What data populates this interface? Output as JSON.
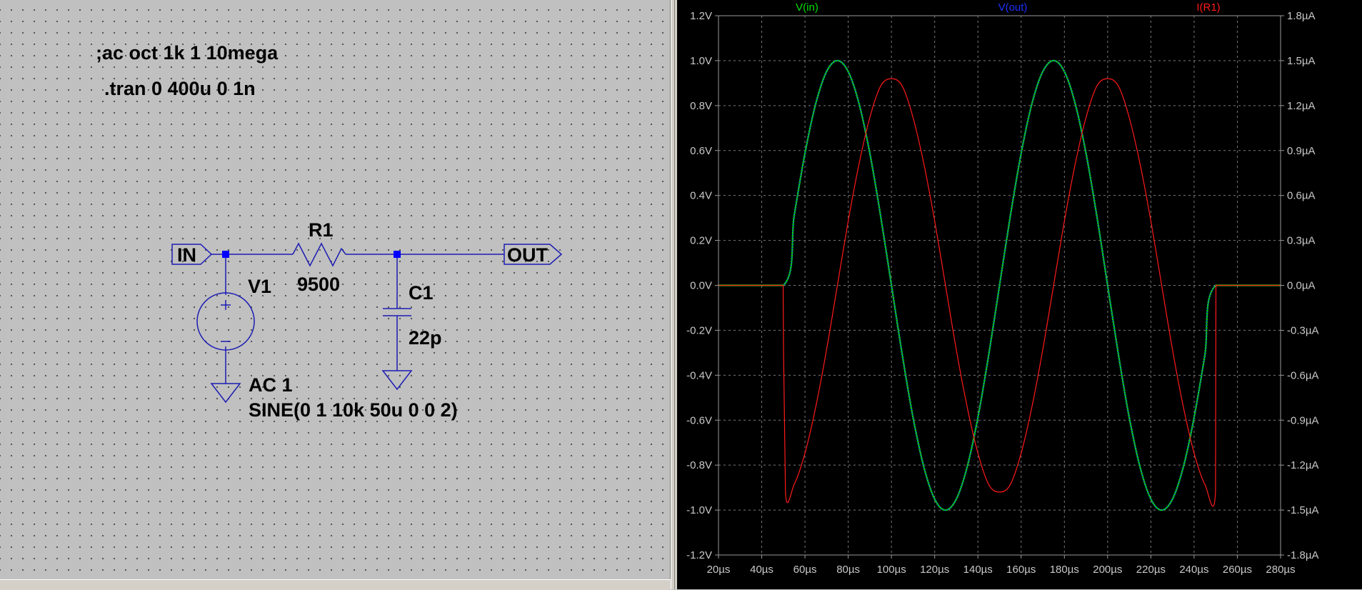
{
  "schematic": {
    "directives": [
      ";ac oct 1k 1 10mega",
      ".tran 0 400u 0 1n"
    ],
    "net_in": "IN",
    "net_out": "OUT",
    "resistor": {
      "name": "R1",
      "value": "9500"
    },
    "capacitor": {
      "name": "C1",
      "value": "22p"
    },
    "source": {
      "name": "V1",
      "ac": "AC 1",
      "tran": "SINE(0 1 10k 50u 0 0 2)"
    },
    "wire_color": "#1c1cb4",
    "node_color": "#0000ff"
  },
  "waveform": {
    "traces": [
      {
        "name": "V(in)",
        "color": "#00e000"
      },
      {
        "name": "V(out)",
        "color": "#2030ff"
      },
      {
        "name": "I(R1)",
        "color": "#ff1a1a"
      }
    ],
    "x_ticks": [
      "20µs",
      "40µs",
      "60µs",
      "80µs",
      "100µs",
      "120µs",
      "140µs",
      "160µs",
      "180µs",
      "200µs",
      "220µs",
      "240µs",
      "260µs",
      "280µs"
    ],
    "y_left_ticks": [
      "1.2V",
      "1.0V",
      "0.8V",
      "0.6V",
      "0.4V",
      "0.2V",
      "0.0V",
      "-0.2V",
      "-0.4V",
      "-0.6V",
      "-0.8V",
      "-1.0V",
      "-1.2V"
    ],
    "y_right_ticks": [
      "1.8µA",
      "1.5µA",
      "1.2µA",
      "0.9µA",
      "0.6µA",
      "0.3µA",
      "0.0µA",
      "-0.3µA",
      "-0.6µA",
      "-0.9µA",
      "-1.2µA",
      "-1.5µA",
      "-1.8µA"
    ]
  },
  "chart_data": {
    "type": "line",
    "x_unit": "µs",
    "xlim": [
      20,
      280
    ],
    "ylim_left": [
      -1.2,
      1.2
    ],
    "ylim_right": [
      -1.8,
      1.8
    ],
    "y_left_unit": "V",
    "y_right_unit": "µA",
    "grid": true,
    "series": [
      {
        "name": "V(in)",
        "axis": "left",
        "color": "#00e000",
        "x": [
          20,
          50,
          55,
          60,
          65,
          70,
          75,
          80,
          85,
          90,
          95,
          100,
          105,
          110,
          115,
          120,
          125,
          130,
          135,
          140,
          145,
          150,
          155,
          160,
          165,
          170,
          175,
          180,
          185,
          190,
          195,
          200,
          205,
          210,
          215,
          220,
          225,
          230,
          235,
          240,
          245,
          250,
          280
        ],
        "y": [
          0,
          0,
          0.309,
          0.588,
          0.809,
          0.951,
          1.0,
          0.951,
          0.809,
          0.588,
          0.309,
          0,
          -0.309,
          -0.588,
          -0.809,
          -0.951,
          -1.0,
          -0.951,
          -0.809,
          -0.588,
          -0.309,
          0,
          0.309,
          0.588,
          0.809,
          0.951,
          1.0,
          0.951,
          0.809,
          0.588,
          0.309,
          0,
          -0.309,
          -0.588,
          -0.809,
          -0.951,
          -1.0,
          -0.951,
          -0.809,
          -0.588,
          -0.309,
          0,
          0
        ]
      },
      {
        "name": "V(out)",
        "axis": "left",
        "color": "#2030ff",
        "x": [
          20,
          50,
          55,
          60,
          65,
          70,
          75,
          80,
          85,
          90,
          95,
          100,
          105,
          110,
          115,
          120,
          125,
          130,
          135,
          140,
          145,
          150,
          155,
          160,
          165,
          170,
          175,
          180,
          185,
          190,
          195,
          200,
          205,
          210,
          215,
          220,
          225,
          230,
          235,
          240,
          245,
          250,
          280
        ],
        "y": [
          0,
          0,
          0.309,
          0.588,
          0.809,
          0.951,
          1.0,
          0.951,
          0.809,
          0.588,
          0.309,
          0,
          -0.309,
          -0.588,
          -0.809,
          -0.951,
          -1.0,
          -0.951,
          -0.809,
          -0.588,
          -0.309,
          0,
          0.309,
          0.588,
          0.809,
          0.951,
          1.0,
          0.951,
          0.809,
          0.588,
          0.309,
          0,
          -0.309,
          -0.588,
          -0.809,
          -0.951,
          -1.0,
          -0.951,
          -0.809,
          -0.588,
          -0.309,
          0,
          0
        ]
      },
      {
        "name": "I(R1)",
        "axis": "right",
        "color": "#ff1a1a",
        "x": [
          20,
          49.9,
          50.1,
          51,
          55,
          60,
          65,
          70,
          75,
          80,
          85,
          90,
          95,
          100,
          105,
          110,
          115,
          120,
          125,
          130,
          135,
          140,
          145,
          150,
          155,
          160,
          165,
          170,
          175,
          180,
          185,
          190,
          195,
          200,
          205,
          210,
          215,
          220,
          225,
          230,
          235,
          240,
          245,
          249.9,
          250.1,
          280
        ],
        "y": [
          0,
          0,
          -0.45,
          -1.39,
          -1.33,
          -1.12,
          -0.81,
          -0.43,
          0,
          0.43,
          0.81,
          1.12,
          1.33,
          1.38,
          1.33,
          1.12,
          0.81,
          0.43,
          0,
          -0.43,
          -0.81,
          -1.12,
          -1.33,
          -1.38,
          -1.33,
          -1.12,
          -0.81,
          -0.43,
          0,
          0.43,
          0.81,
          1.12,
          1.33,
          1.38,
          1.33,
          1.12,
          0.81,
          0.43,
          0,
          -0.43,
          -0.81,
          -1.12,
          -1.33,
          -1.38,
          0,
          0
        ]
      }
    ]
  }
}
